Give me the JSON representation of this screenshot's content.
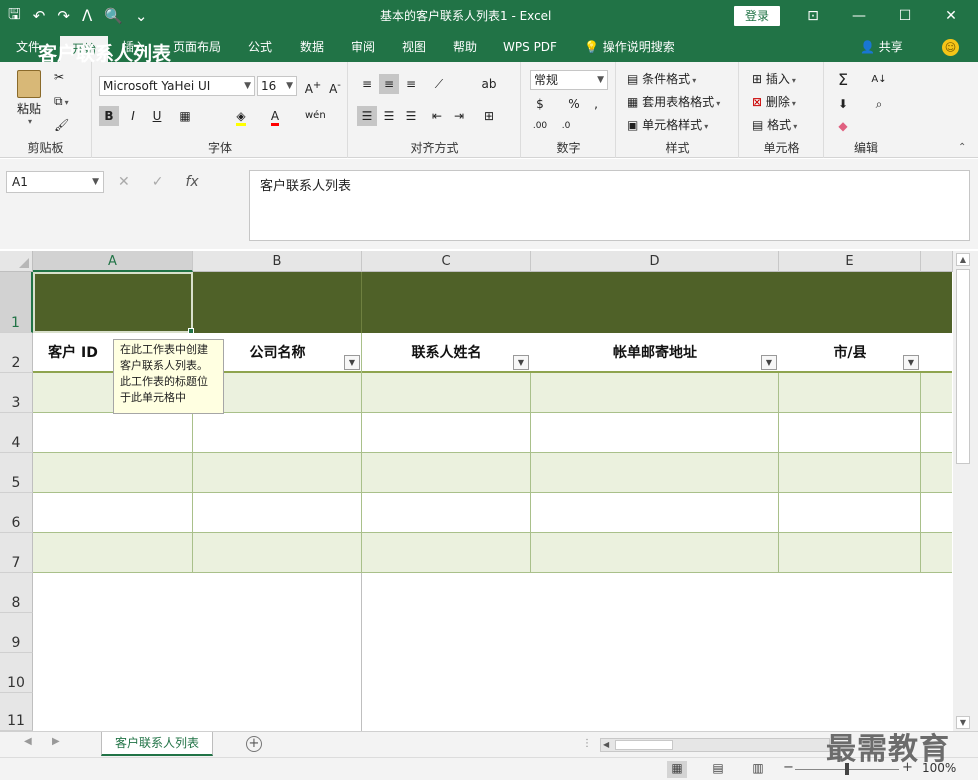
{
  "window": {
    "title": "基本的客户联系人列表1  -  Excel",
    "login_label": "登录",
    "controls": {
      "ribbon_display": "⊡",
      "minimize": "—",
      "maximize": "☐",
      "close": "✕"
    }
  },
  "qat": {
    "save": "🖫",
    "undo": "↶",
    "redo": "↷",
    "touch": "ᐱ",
    "preview": "🔍",
    "customize": "⌄"
  },
  "tabs": [
    "文件",
    "开始",
    "插入",
    "页面布局",
    "公式",
    "数据",
    "审阅",
    "视图",
    "帮助",
    "WPS PDF"
  ],
  "active_tab": "开始",
  "tell_me": "操作说明搜索",
  "share": "共享",
  "ribbon": {
    "clipboard": {
      "label": "剪贴板",
      "paste": "粘贴"
    },
    "font": {
      "label": "字体",
      "name": "Microsoft YaHei UI",
      "size": "16",
      "bold": "B",
      "italic": "I",
      "underline": "U"
    },
    "alignment": {
      "label": "对齐方式"
    },
    "number": {
      "label": "数字",
      "format": "常规",
      "percent": "%",
      "comma": ","
    },
    "styles": {
      "label": "样式",
      "conditional": "条件格式",
      "table": "套用表格格式",
      "cell": "单元格样式"
    },
    "cells": {
      "label": "单元格",
      "insert": "插入",
      "delete": "删除",
      "format": "格式"
    },
    "editing": {
      "label": "编辑"
    }
  },
  "formula_bar": {
    "name_box": "A1",
    "content": "客户联系人列表",
    "fx": "fx",
    "cancel": "✕",
    "enter": "✓"
  },
  "columns": [
    "A",
    "B",
    "C",
    "D",
    "E"
  ],
  "rows": [
    "1",
    "2",
    "3",
    "4",
    "5",
    "6",
    "7",
    "8",
    "9",
    "10",
    "11"
  ],
  "sheet": {
    "title": "客户联系人列表",
    "headers": [
      "客户 ID",
      "公司名称",
      "联系人姓名",
      "帐单邮寄地址",
      "市/县"
    ],
    "tooltip": [
      "在此工作表中创建",
      "客户联系人列表。",
      "此工作表的标题位",
      "于此单元格中"
    ]
  },
  "sheet_tab": "客户联系人列表",
  "add_sheet": "+",
  "zoom": "100%",
  "watermark": "最需教育"
}
